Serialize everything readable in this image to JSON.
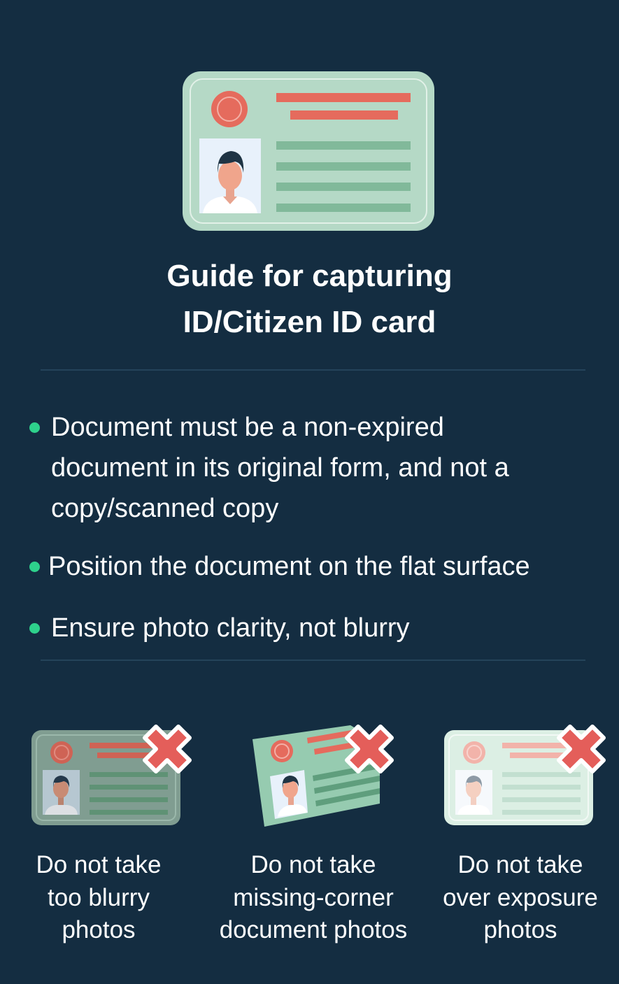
{
  "title": {
    "line1": "Guide for capturing",
    "line2": "ID/Citizen ID card"
  },
  "icons": {
    "hero": "id-card-icon",
    "reject": "red-x-icon"
  },
  "rules": [
    {
      "lines": [
        "Document must be a non-expired",
        "document in its original form, and not a",
        "copy/scanned copy"
      ]
    },
    {
      "lines": [
        "Position the document on the flat surface"
      ]
    },
    {
      "lines": [
        "Ensure photo clarity, not blurry"
      ]
    }
  ],
  "warnings": [
    {
      "lines": [
        "Do not take",
        "too blurry",
        "photos"
      ]
    },
    {
      "lines": [
        "Do not take",
        "missing-corner",
        "document photos"
      ]
    },
    {
      "lines": [
        "Do not take",
        "over exposure",
        "photos"
      ]
    }
  ],
  "colors": {
    "background": "#142d41",
    "card": "#b5d9c6",
    "card_lines": "#81b99a",
    "accent_red": "#e56b5d",
    "bullet": "#2ed18c",
    "reject_x": "#e45e5a"
  }
}
